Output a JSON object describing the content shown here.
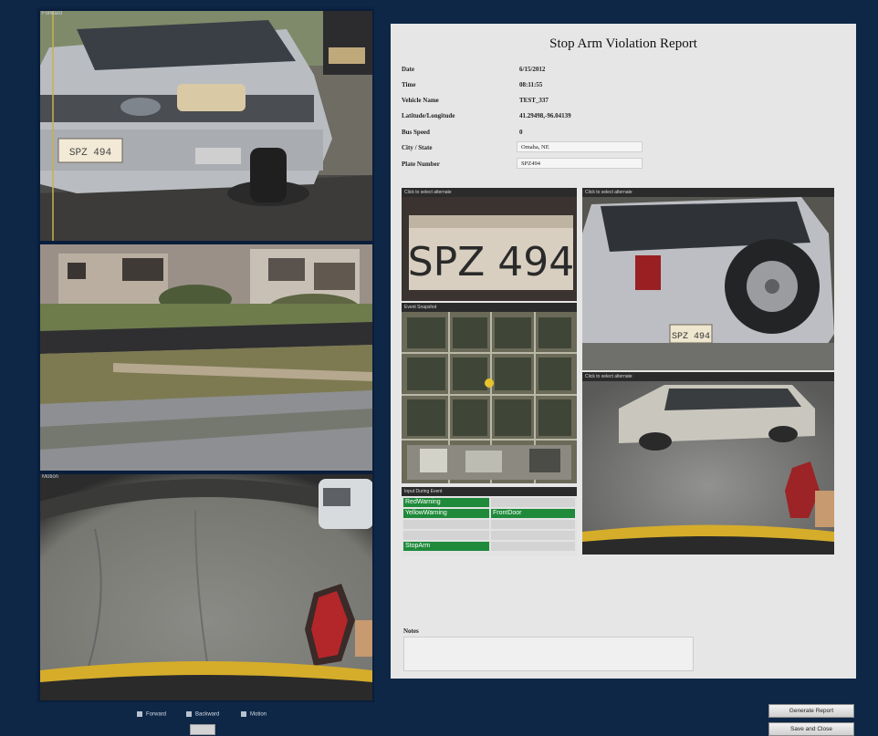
{
  "cameras": {
    "forward_label": "Forward",
    "backward_label": "",
    "motion_label": "Motion"
  },
  "report": {
    "title": "Stop Arm Violation Report",
    "fields": [
      {
        "label": "Date",
        "value": "6/15/2012"
      },
      {
        "label": "Time",
        "value": "08:11:55"
      },
      {
        "label": "Vehicle Name",
        "value": "TEST_337"
      },
      {
        "label": "Latitude/Longitude",
        "value": "41.29498,-96.04139"
      },
      {
        "label": "Bus Speed",
        "value": "0"
      },
      {
        "label": "City / State",
        "value": "Omaha, NE"
      },
      {
        "label": "Plate Number",
        "value": "SPZ494"
      }
    ],
    "panels": {
      "plate_head": "Click to select alternate",
      "rear_head": "Click to select alternate",
      "map_head": "Event Snapshot",
      "side_head": "Click to select alternate",
      "inputs_head": "Input During Event"
    },
    "plate_text": "SPZ 494",
    "rear_plate_text": "SPZ 494",
    "inputs": {
      "left": [
        "RedWarning",
        "YellowWarning",
        "",
        "",
        "StopArm"
      ],
      "right": [
        "",
        "FrontDoor",
        "",
        "",
        ""
      ]
    },
    "notes_label": "Notes"
  },
  "footer": {
    "legend": [
      "Forward",
      "Backward",
      "Motion"
    ],
    "generate_button": "Generate Report",
    "save_button": "Save and Close"
  },
  "colors": {
    "background": "#0e2747",
    "report_bg": "#e6e6e6",
    "input_active": "#1e8a3a"
  }
}
